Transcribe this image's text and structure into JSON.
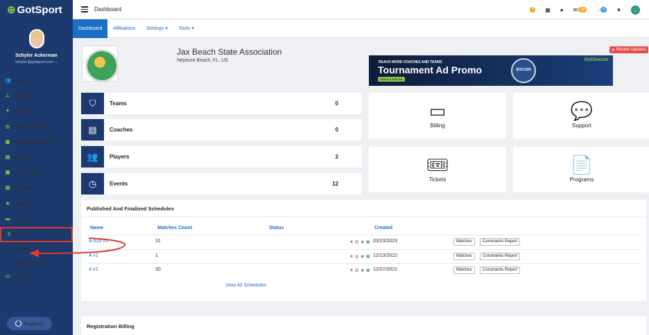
{
  "app": {
    "logo": "GotSport"
  },
  "user": {
    "name": "Schyler Ackerman",
    "email": "schyler@gotsport.com"
  },
  "sidebar": {
    "items": [
      {
        "label": "Users",
        "icon": "users-icon",
        "glyph": "👥"
      },
      {
        "label": "Association",
        "icon": "sitemap-icon",
        "glyph": "⊥"
      },
      {
        "label": "Venues",
        "icon": "map-icon",
        "glyph": "✦"
      },
      {
        "label": "Communications",
        "icon": "chat-icon",
        "glyph": "◎"
      },
      {
        "label": "Club Management",
        "icon": "building-icon",
        "glyph": "▣"
      },
      {
        "label": "Programs",
        "icon": "clipboard-icon",
        "glyph": "▤"
      },
      {
        "label": "Scheduling",
        "icon": "calendar-icon",
        "glyph": "▦"
      },
      {
        "label": "Archives",
        "icon": "archive-icon",
        "glyph": "▧"
      },
      {
        "label": "Features",
        "icon": "star-icon",
        "glyph": "★"
      },
      {
        "label": "Billing",
        "icon": "credit-card-icon",
        "glyph": "▬"
      },
      {
        "label": "Forms",
        "icon": "document-icon",
        "glyph": "▯"
      },
      {
        "label": "Stores",
        "icon": "store-icon",
        "glyph": "▭"
      }
    ],
    "forms_sub": [
      "Forms",
      "Registrations"
    ],
    "support": "Support"
  },
  "topbar": {
    "title": "Dashboard",
    "mail_count": "18",
    "chat_count": "0"
  },
  "tabs": [
    "Dashboard",
    "Affiliations",
    "Settings ▾",
    "Tools ▾"
  ],
  "header": {
    "club_name": "Jax Beach State Association",
    "location": "Neptune Beach, FL, US",
    "recent_updates": "Recent Updates"
  },
  "ad": {
    "tagline": "REACH MORE COACHES AND TEAMS",
    "headline": "Tournament Ad Promo",
    "cta": "Select a Service",
    "brand": "GotSoccer",
    "badge_text": "SOCCER"
  },
  "stats": [
    {
      "label": "Teams",
      "value": "0",
      "icon": "shield-icon",
      "glyph": "⛉"
    },
    {
      "label": "Coaches",
      "value": "0",
      "icon": "book-icon",
      "glyph": "▤"
    },
    {
      "label": "Players",
      "value": "2",
      "icon": "players-icon",
      "glyph": "👥"
    },
    {
      "label": "Events",
      "value": "12",
      "icon": "clock-icon",
      "glyph": "◷"
    }
  ],
  "tiles": [
    {
      "label": "Billing",
      "icon": "credit-card-icon",
      "glyph": "▭"
    },
    {
      "label": "Support",
      "icon": "comments-icon",
      "glyph": "💬"
    },
    {
      "label": "Tickets",
      "icon": "ticket-icon",
      "glyph": "🎟"
    },
    {
      "label": "Programs",
      "icon": "file-icon",
      "glyph": "📄"
    }
  ],
  "schedules": {
    "title": "Published And Finalized Schedules",
    "columns": [
      "Name",
      "Matches Count",
      "Status",
      "Created"
    ],
    "rows": [
      {
        "name": "A-616 v1",
        "count": "31",
        "created": "03/23/2023"
      },
      {
        "name": "A v1",
        "count": "1",
        "created": "12/13/2022"
      },
      {
        "name": "A v1",
        "count": "30",
        "created": "12/07/2022"
      }
    ],
    "matches_btn": "Matches",
    "constraints_btn": "Constraints Report",
    "view_all": "View All Schedules"
  },
  "registration_billing": "Registration Billing",
  "colors": {
    "sidebar": "#1c3a6e",
    "accent": "#1a6fc4",
    "highlight": "#e03a2a",
    "brand_green": "#8dc63f"
  }
}
